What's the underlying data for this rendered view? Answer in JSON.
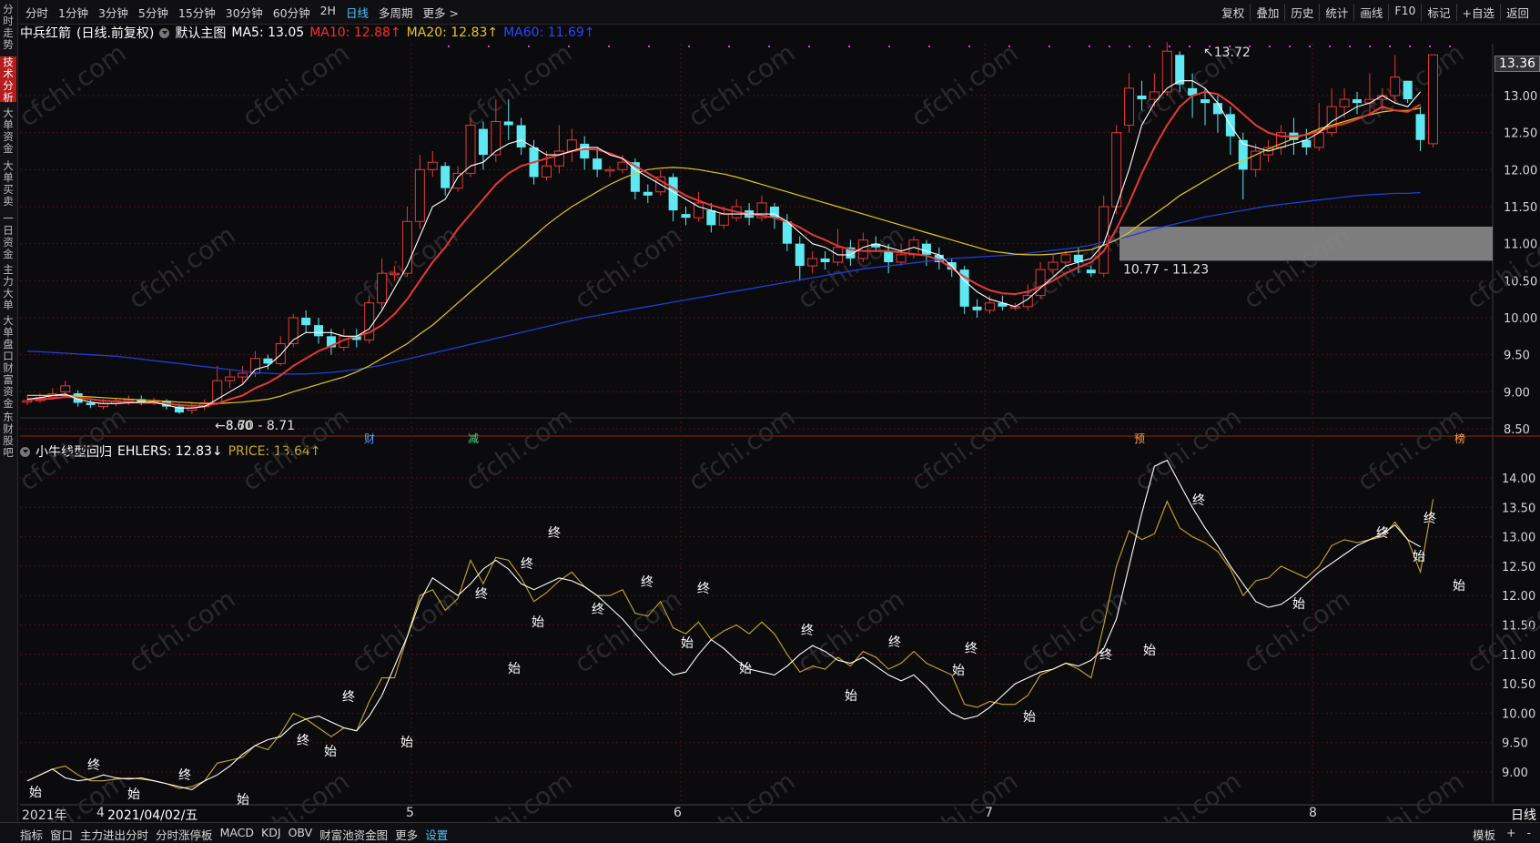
{
  "topbar": {
    "periods": [
      "分时",
      "1分钟",
      "3分钟",
      "5分钟",
      "15分钟",
      "30分钟",
      "60分钟",
      "2H",
      "日线",
      "多周期",
      "更多 >"
    ],
    "active_period": "日线",
    "right_tools": [
      "复权",
      "叠加",
      "历史",
      "统计",
      "画线",
      "F10",
      "标记",
      "+自选",
      "返回"
    ]
  },
  "left_tabs": [
    "分时走势",
    "技术分析",
    "大单资金",
    "大单买卖",
    "一日资金",
    "主力大单",
    "大单盘口",
    "财富资金",
    "东财股吧"
  ],
  "active_left_tab": "技术分析",
  "main_chart": {
    "stock": "中兵红箭",
    "mode": "(日线.前复权)",
    "template": "默认主图",
    "ma5": "MA5: 13.05",
    "ma10": "MA10: 12.88↑",
    "ma20": "MA20: 12.83↑",
    "ma60": "MA60: 11.69↑",
    "high_label": "13.72",
    "low_label": "8.70 - 8.71",
    "low_label_2": "8.60",
    "gap_label": "10.77 - 11.23",
    "last_price_tag": "13.36",
    "price_ticks": [
      "13.00",
      "12.50",
      "12.00",
      "11.50",
      "11.00",
      "10.50",
      "10.00",
      "9.50",
      "9.00",
      "8.50"
    ],
    "markers": [
      "财",
      "减",
      "预",
      "榜"
    ]
  },
  "sub_chart": {
    "name": "小牛线型回归",
    "ehlers": "EHLERS: 12.83↓",
    "price": "PRICE: 13.64↑",
    "ticks": [
      "14.00",
      "13.50",
      "13.00",
      "12.50",
      "12.00",
      "11.50",
      "11.00",
      "10.50",
      "10.00",
      "9.50",
      "9.00"
    ],
    "start_label": "始",
    "end_label": "终"
  },
  "time_axis": {
    "year": "2021年",
    "month_4": "4",
    "cursor_date": "2021/04/02/五",
    "labels": [
      "5",
      "6",
      "7",
      "8"
    ],
    "period_label": "日线"
  },
  "bottom_bar": {
    "items": [
      "指标",
      "窗口",
      "主力进出分时",
      "分时涨停板",
      "MACD",
      "KDJ",
      "OBV",
      "财富池资金图",
      "更多",
      "设置"
    ],
    "active": "设置",
    "right": [
      "模板",
      "+",
      "-"
    ]
  },
  "watermark": "cfchi.com",
  "colors": {
    "ma5": "#ffffff",
    "ma10": "#e53935",
    "ma20": "#e6c619",
    "ma60": "#1e3fd6",
    "up": "#e53935",
    "down": "#5de8f2",
    "ehlers": "#ffffff",
    "price": "#c9a826"
  },
  "chart_data": {
    "type": "candlestick",
    "ylim": [
      8.4,
      13.9
    ],
    "candles": [
      [
        8.86,
        8.88,
        8.82,
        8.95
      ],
      [
        8.88,
        8.92,
        8.85,
        8.98
      ],
      [
        8.93,
        8.97,
        8.9,
        9.05
      ],
      [
        9.0,
        9.08,
        8.95,
        9.15
      ],
      [
        8.98,
        8.85,
        8.8,
        9.02
      ],
      [
        8.85,
        8.82,
        8.78,
        8.9
      ],
      [
        8.8,
        8.84,
        8.76,
        8.9
      ],
      [
        8.84,
        8.88,
        8.8,
        8.92
      ],
      [
        8.88,
        8.9,
        8.82,
        8.95
      ],
      [
        8.9,
        8.86,
        8.82,
        8.95
      ],
      [
        8.86,
        8.88,
        8.82,
        8.92
      ],
      [
        8.88,
        8.8,
        8.76,
        8.9
      ],
      [
        8.8,
        8.72,
        8.7,
        8.84
      ],
      [
        8.75,
        8.78,
        8.7,
        8.85
      ],
      [
        8.8,
        8.85,
        8.75,
        8.9
      ],
      [
        8.85,
        9.15,
        8.82,
        9.35
      ],
      [
        9.15,
        9.2,
        9.05,
        9.3
      ],
      [
        9.2,
        9.25,
        9.1,
        9.35
      ],
      [
        9.25,
        9.45,
        9.2,
        9.55
      ],
      [
        9.45,
        9.38,
        9.3,
        9.5
      ],
      [
        9.38,
        9.65,
        9.35,
        9.75
      ],
      [
        9.65,
        10.0,
        9.6,
        10.05
      ],
      [
        10.0,
        9.9,
        9.8,
        10.1
      ],
      [
        9.9,
        9.75,
        9.65,
        10.0
      ],
      [
        9.75,
        9.6,
        9.5,
        9.85
      ],
      [
        9.6,
        9.75,
        9.55,
        9.85
      ],
      [
        9.75,
        9.7,
        9.6,
        9.85
      ],
      [
        9.7,
        10.2,
        9.65,
        10.3
      ],
      [
        10.2,
        10.6,
        10.1,
        10.8
      ],
      [
        10.6,
        10.6,
        10.5,
        10.7
      ],
      [
        10.6,
        11.3,
        10.55,
        11.5
      ],
      [
        11.3,
        12.0,
        11.2,
        12.2
      ],
      [
        12.0,
        12.1,
        11.9,
        12.25
      ],
      [
        12.05,
        11.75,
        11.65,
        12.1
      ],
      [
        11.75,
        11.95,
        11.7,
        12.05
      ],
      [
        11.95,
        12.6,
        11.9,
        12.7
      ],
      [
        12.55,
        12.2,
        12.0,
        12.65
      ],
      [
        12.2,
        12.65,
        12.1,
        12.95
      ],
      [
        12.65,
        12.6,
        12.4,
        12.95
      ],
      [
        12.6,
        12.3,
        12.2,
        12.7
      ],
      [
        12.3,
        11.9,
        11.8,
        12.4
      ],
      [
        11.9,
        12.05,
        11.85,
        12.25
      ],
      [
        12.05,
        12.25,
        11.95,
        12.6
      ],
      [
        12.25,
        12.4,
        12.1,
        12.55
      ],
      [
        12.35,
        12.15,
        12.0,
        12.45
      ],
      [
        12.15,
        12.0,
        11.9,
        12.3
      ],
      [
        12.0,
        12.0,
        11.9,
        12.05
      ],
      [
        12.0,
        12.1,
        11.95,
        12.2
      ],
      [
        12.1,
        11.7,
        11.6,
        12.15
      ],
      [
        11.7,
        11.65,
        11.55,
        11.8
      ],
      [
        11.7,
        11.9,
        11.65,
        12.0
      ],
      [
        11.9,
        11.45,
        11.3,
        11.95
      ],
      [
        11.4,
        11.35,
        11.25,
        11.5
      ],
      [
        11.35,
        11.55,
        11.3,
        11.7
      ],
      [
        11.45,
        11.25,
        11.15,
        11.55
      ],
      [
        11.25,
        11.4,
        11.2,
        11.5
      ],
      [
        11.35,
        11.5,
        11.3,
        11.6
      ],
      [
        11.45,
        11.35,
        11.25,
        11.55
      ],
      [
        11.35,
        11.55,
        11.3,
        11.65
      ],
      [
        11.5,
        11.35,
        11.2,
        11.55
      ],
      [
        11.3,
        11.0,
        10.9,
        11.4
      ],
      [
        11.0,
        10.7,
        10.5,
        11.1
      ],
      [
        10.7,
        10.8,
        10.6,
        10.9
      ],
      [
        10.8,
        10.75,
        10.65,
        10.9
      ],
      [
        10.75,
        10.95,
        10.7,
        11.2
      ],
      [
        10.95,
        10.8,
        10.7,
        11.05
      ],
      [
        10.8,
        11.05,
        10.75,
        11.15
      ],
      [
        11.0,
        10.95,
        10.9,
        11.1
      ],
      [
        10.9,
        10.75,
        10.6,
        11.0
      ],
      [
        10.75,
        10.85,
        10.7,
        11.0
      ],
      [
        10.85,
        11.05,
        10.8,
        11.1
      ],
      [
        11.0,
        10.85,
        10.7,
        11.05
      ],
      [
        10.85,
        10.75,
        10.65,
        10.95
      ],
      [
        10.75,
        10.65,
        10.55,
        10.8
      ],
      [
        10.65,
        10.15,
        10.05,
        10.7
      ],
      [
        10.15,
        10.1,
        10.0,
        10.25
      ],
      [
        10.1,
        10.2,
        10.05,
        10.3
      ],
      [
        10.2,
        10.15,
        10.1,
        10.3
      ],
      [
        10.15,
        10.15,
        10.1,
        10.2
      ],
      [
        10.15,
        10.3,
        10.1,
        10.45
      ],
      [
        10.3,
        10.65,
        10.25,
        10.75
      ],
      [
        10.65,
        10.75,
        10.6,
        10.85
      ],
      [
        10.75,
        10.85,
        10.7,
        10.9
      ],
      [
        10.85,
        10.75,
        10.6,
        10.95
      ],
      [
        10.65,
        10.6,
        10.55,
        10.7
      ],
      [
        10.6,
        11.5,
        10.55,
        11.65
      ],
      [
        11.5,
        12.5,
        11.4,
        12.6
      ],
      [
        12.6,
        13.1,
        12.5,
        13.3
      ],
      [
        13.0,
        12.95,
        12.8,
        13.2
      ],
      [
        12.95,
        13.05,
        12.85,
        13.3
      ],
      [
        13.05,
        13.6,
        13.0,
        13.72
      ],
      [
        13.55,
        13.15,
        13.05,
        13.6
      ],
      [
        13.1,
        13.0,
        12.7,
        13.3
      ],
      [
        12.95,
        12.9,
        12.6,
        13.1
      ],
      [
        12.9,
        12.75,
        12.5,
        13.0
      ],
      [
        12.75,
        12.45,
        12.2,
        12.85
      ],
      [
        12.4,
        12.0,
        11.6,
        12.5
      ],
      [
        12.0,
        12.25,
        11.9,
        12.35
      ],
      [
        12.2,
        12.3,
        12.1,
        12.4
      ],
      [
        12.3,
        12.5,
        12.2,
        12.6
      ],
      [
        12.5,
        12.4,
        12.2,
        12.7
      ],
      [
        12.4,
        12.3,
        12.2,
        12.55
      ],
      [
        12.3,
        12.5,
        12.25,
        12.9
      ],
      [
        12.5,
        12.85,
        12.45,
        13.1
      ],
      [
        12.85,
        12.95,
        12.7,
        13.1
      ],
      [
        12.95,
        12.9,
        12.75,
        13.05
      ],
      [
        12.9,
        12.95,
        12.75,
        13.3
      ],
      [
        12.95,
        13.0,
        12.8,
        13.1
      ],
      [
        13.0,
        13.25,
        12.9,
        13.55
      ],
      [
        13.2,
        12.95,
        12.9,
        13.2
      ],
      [
        12.75,
        12.4,
        12.25,
        12.85
      ],
      [
        12.35,
        13.55,
        12.3,
        13.55
      ]
    ],
    "ma5": [
      8.9,
      8.92,
      8.95,
      8.97,
      8.9,
      8.86,
      8.84,
      8.84,
      8.85,
      8.86,
      8.86,
      8.82,
      8.78,
      8.78,
      8.8,
      8.9,
      9.0,
      9.1,
      9.3,
      9.35,
      9.5,
      9.7,
      9.8,
      9.8,
      9.8,
      9.75,
      9.75,
      9.85,
      10.1,
      10.4,
      10.7,
      11.1,
      11.5,
      11.6,
      11.9,
      12.05,
      12.1,
      12.25,
      12.35,
      12.4,
      12.3,
      12.2,
      12.2,
      12.25,
      12.3,
      12.3,
      12.2,
      12.15,
      12.0,
      11.9,
      11.8,
      11.7,
      11.6,
      11.5,
      11.45,
      11.4,
      11.4,
      11.4,
      11.4,
      11.4,
      11.3,
      11.15,
      11.0,
      10.95,
      10.85,
      10.85,
      10.95,
      11.0,
      10.95,
      10.9,
      10.95,
      10.9,
      10.85,
      10.7,
      10.5,
      10.35,
      10.25,
      10.2,
      10.15,
      10.25,
      10.4,
      10.55,
      10.7,
      10.75,
      10.8,
      11.0,
      11.5,
      12.0,
      12.6,
      12.9,
      13.1,
      13.2,
      13.2,
      13.1,
      12.9,
      12.6,
      12.35,
      12.3,
      12.25,
      12.3,
      12.35,
      12.4,
      12.5,
      12.65,
      12.75,
      12.85,
      12.9,
      13.0,
      12.9,
      12.85,
      13.05
    ],
    "ma10": [
      8.9,
      8.9,
      8.91,
      8.93,
      8.92,
      8.9,
      8.88,
      8.87,
      8.86,
      8.85,
      8.85,
      8.84,
      8.82,
      8.81,
      8.81,
      8.84,
      8.9,
      8.95,
      9.05,
      9.12,
      9.22,
      9.35,
      9.45,
      9.55,
      9.62,
      9.7,
      9.75,
      9.8,
      9.9,
      10.05,
      10.25,
      10.5,
      10.75,
      10.95,
      11.2,
      11.4,
      11.6,
      11.8,
      11.95,
      12.05,
      12.1,
      12.15,
      12.2,
      12.25,
      12.28,
      12.27,
      12.22,
      12.15,
      12.05,
      11.95,
      11.85,
      11.75,
      11.65,
      11.58,
      11.52,
      11.47,
      11.43,
      11.4,
      11.38,
      11.35,
      11.3,
      11.22,
      11.12,
      11.05,
      10.97,
      10.92,
      10.9,
      10.9,
      10.9,
      10.88,
      10.86,
      10.84,
      10.78,
      10.67,
      10.55,
      10.45,
      10.37,
      10.33,
      10.32,
      10.35,
      10.42,
      10.5,
      10.6,
      10.68,
      10.75,
      10.9,
      11.2,
      11.55,
      11.95,
      12.3,
      12.6,
      12.85,
      13.0,
      13.05,
      13.02,
      12.9,
      12.75,
      12.6,
      12.5,
      12.45,
      12.45,
      12.47,
      12.52,
      12.58,
      12.62,
      12.68,
      12.75,
      12.85,
      12.8,
      12.78,
      12.88
    ],
    "ma20": [
      8.95,
      8.95,
      8.95,
      8.95,
      8.94,
      8.93,
      8.92,
      8.91,
      8.9,
      8.89,
      8.88,
      8.87,
      8.86,
      8.85,
      8.84,
      8.84,
      8.85,
      8.86,
      8.88,
      8.9,
      8.94,
      9.0,
      9.05,
      9.1,
      9.15,
      9.2,
      9.27,
      9.35,
      9.45,
      9.55,
      9.65,
      9.78,
      9.9,
      10.05,
      10.2,
      10.35,
      10.5,
      10.65,
      10.8,
      10.95,
      11.1,
      11.25,
      11.38,
      11.5,
      11.6,
      11.7,
      11.8,
      11.88,
      11.95,
      12.0,
      12.02,
      12.03,
      12.02,
      12.0,
      11.97,
      11.94,
      11.9,
      11.85,
      11.8,
      11.75,
      11.7,
      11.65,
      11.6,
      11.55,
      11.5,
      11.45,
      11.4,
      11.35,
      11.3,
      11.25,
      11.2,
      11.15,
      11.1,
      11.05,
      11.0,
      10.95,
      10.9,
      10.88,
      10.86,
      10.85,
      10.85,
      10.86,
      10.88,
      10.9,
      10.92,
      10.98,
      11.05,
      11.15,
      11.28,
      11.4,
      11.52,
      11.65,
      11.75,
      11.85,
      11.95,
      12.05,
      12.12,
      12.2,
      12.28,
      12.35,
      12.42,
      12.48,
      12.55,
      12.6,
      12.65,
      12.7,
      12.74,
      12.78,
      12.8,
      12.8,
      12.83
    ],
    "ma60": [
      9.55,
      9.54,
      9.53,
      9.52,
      9.51,
      9.5,
      9.49,
      9.48,
      9.46,
      9.44,
      9.42,
      9.4,
      9.38,
      9.36,
      9.34,
      9.32,
      9.3,
      9.28,
      9.26,
      9.25,
      9.24,
      9.24,
      9.24,
      9.25,
      9.26,
      9.28,
      9.3,
      9.33,
      9.36,
      9.4,
      9.44,
      9.48,
      9.52,
      9.56,
      9.6,
      9.64,
      9.68,
      9.72,
      9.76,
      9.8,
      9.84,
      9.88,
      9.92,
      9.96,
      10.0,
      10.03,
      10.06,
      10.09,
      10.12,
      10.15,
      10.18,
      10.21,
      10.24,
      10.27,
      10.3,
      10.33,
      10.36,
      10.39,
      10.42,
      10.45,
      10.48,
      10.51,
      10.54,
      10.57,
      10.6,
      10.63,
      10.66,
      10.68,
      10.7,
      10.72,
      10.74,
      10.76,
      10.78,
      10.8,
      10.81,
      10.82,
      10.83,
      10.84,
      10.85,
      10.87,
      10.89,
      10.91,
      10.93,
      10.95,
      10.98,
      11.02,
      11.06,
      11.1,
      11.15,
      11.2,
      11.24,
      11.28,
      11.32,
      11.36,
      11.39,
      11.42,
      11.45,
      11.48,
      11.51,
      11.53,
      11.55,
      11.57,
      11.59,
      11.61,
      11.63,
      11.65,
      11.66,
      11.67,
      11.68,
      11.68,
      11.69
    ],
    "ehlers": [
      8.85,
      8.95,
      9.05,
      8.9,
      8.85,
      8.88,
      8.95,
      8.9,
      8.88,
      8.9,
      8.85,
      8.8,
      8.75,
      8.7,
      8.85,
      8.95,
      9.1,
      9.3,
      9.45,
      9.55,
      9.6,
      9.8,
      9.9,
      9.95,
      9.85,
      9.75,
      9.7,
      9.95,
      10.3,
      10.8,
      11.3,
      11.9,
      12.3,
      12.15,
      12.0,
      12.2,
      12.45,
      12.6,
      12.45,
      12.2,
      12.1,
      12.2,
      12.3,
      12.25,
      12.15,
      12.0,
      11.8,
      11.6,
      11.35,
      11.1,
      10.85,
      10.65,
      10.7,
      11.0,
      11.25,
      11.1,
      10.9,
      10.75,
      10.7,
      10.65,
      10.8,
      11.0,
      11.15,
      11.05,
      10.9,
      10.85,
      10.95,
      10.8,
      10.65,
      10.55,
      10.65,
      10.45,
      10.2,
      10.0,
      9.9,
      9.95,
      10.1,
      10.3,
      10.5,
      10.6,
      10.7,
      10.75,
      10.85,
      10.8,
      10.9,
      11.1,
      11.6,
      12.5,
      13.4,
      14.2,
      14.3,
      13.9,
      13.5,
      13.15,
      12.85,
      12.5,
      12.2,
      11.9,
      11.8,
      11.85,
      12.0,
      12.2,
      12.4,
      12.55,
      12.7,
      12.85,
      12.95,
      13.05,
      13.2,
      12.95,
      12.83
    ],
    "price": [
      8.85,
      8.95,
      9.05,
      9.1,
      8.95,
      8.85,
      8.85,
      8.88,
      8.9,
      8.88,
      8.85,
      8.8,
      8.72,
      8.75,
      8.85,
      9.15,
      9.2,
      9.25,
      9.45,
      9.38,
      9.65,
      10.0,
      9.9,
      9.75,
      9.6,
      9.75,
      9.7,
      10.2,
      10.6,
      10.6,
      11.3,
      12.0,
      12.1,
      11.75,
      11.95,
      12.6,
      12.2,
      12.65,
      12.6,
      12.3,
      11.9,
      12.05,
      12.25,
      12.4,
      12.15,
      12.0,
      12.0,
      12.1,
      11.7,
      11.65,
      11.9,
      11.45,
      11.35,
      11.55,
      11.25,
      11.4,
      11.5,
      11.35,
      11.55,
      11.35,
      11.0,
      10.7,
      10.8,
      10.75,
      10.95,
      10.8,
      11.05,
      10.95,
      10.75,
      10.85,
      11.05,
      10.85,
      10.75,
      10.65,
      10.15,
      10.1,
      10.2,
      10.15,
      10.15,
      10.3,
      10.65,
      10.75,
      10.85,
      10.75,
      10.6,
      11.5,
      12.5,
      13.1,
      12.95,
      13.05,
      13.6,
      13.15,
      13.0,
      12.9,
      12.75,
      12.45,
      12.0,
      12.25,
      12.3,
      12.5,
      12.4,
      12.3,
      12.5,
      12.85,
      12.95,
      12.9,
      12.95,
      13.0,
      13.25,
      12.95,
      12.4,
      13.64
    ]
  }
}
